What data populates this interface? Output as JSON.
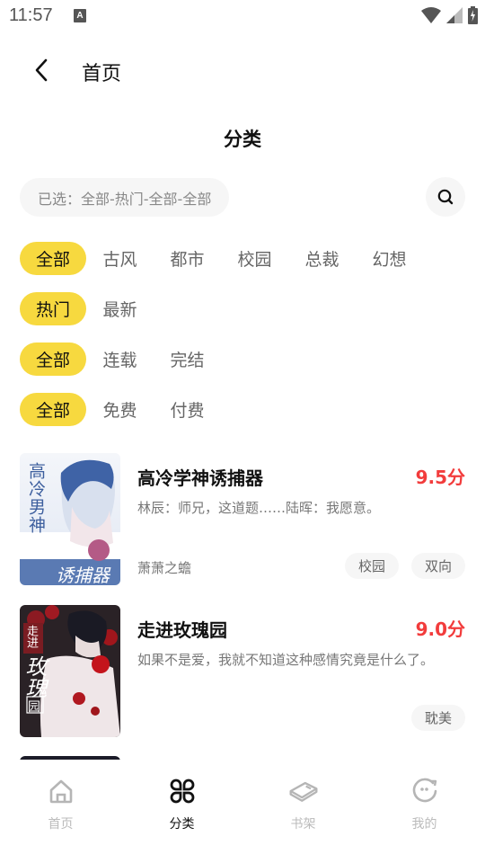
{
  "status_bar": {
    "time": "11:57",
    "notification_icon": "a-keyboard-icon",
    "icons": [
      "wifi-icon",
      "cell-signal-icon",
      "battery-charging-icon"
    ]
  },
  "header": {
    "back_icon": "chevron-left-icon",
    "title": "首页"
  },
  "section_title": "分类",
  "selected": {
    "text": "已选：全部-热门-全部-全部"
  },
  "search_icon": "search-icon",
  "filters": [
    {
      "name": "genre",
      "options": [
        "全部",
        "古风",
        "都市",
        "校园",
        "总裁",
        "幻想"
      ],
      "selected": 0
    },
    {
      "name": "sort",
      "options": [
        "热门",
        "最新"
      ],
      "selected": 0
    },
    {
      "name": "status",
      "options": [
        "全部",
        "连载",
        "完结"
      ],
      "selected": 0
    },
    {
      "name": "price",
      "options": [
        "全部",
        "免费",
        "付费"
      ],
      "selected": 0
    }
  ],
  "books": [
    {
      "title": "高冷学神诱捕器",
      "score": "9.5分",
      "desc": "林辰：师兄，这道题……陆晖：我愿意。",
      "author": "萧萧之蟾",
      "tags": [
        "校园",
        "双向"
      ],
      "cover": {
        "title_top": "高冷男神",
        "title_bottom": "诱捕器",
        "palette": [
          "#eef1f7",
          "#4c6fa8"
        ]
      }
    },
    {
      "title": "走进玫瑰园",
      "score": "9.0分",
      "desc": "如果不是爱，我就不知道这种感情究竟是什么了。",
      "author": "",
      "tags": [
        "耽美"
      ],
      "cover": {
        "title_top": "走进",
        "title_main": "玫瑰",
        "title_bottom": "园",
        "palette": [
          "#2a1f22",
          "#b0151c"
        ]
      }
    }
  ],
  "bottom_nav": {
    "items": [
      {
        "label": "首页",
        "icon": "home-icon",
        "active": false
      },
      {
        "label": "分类",
        "icon": "category-icon",
        "active": true
      },
      {
        "label": "书架",
        "icon": "bookshelf-icon",
        "active": false
      },
      {
        "label": "我的",
        "icon": "profile-icon",
        "active": false
      }
    ]
  }
}
